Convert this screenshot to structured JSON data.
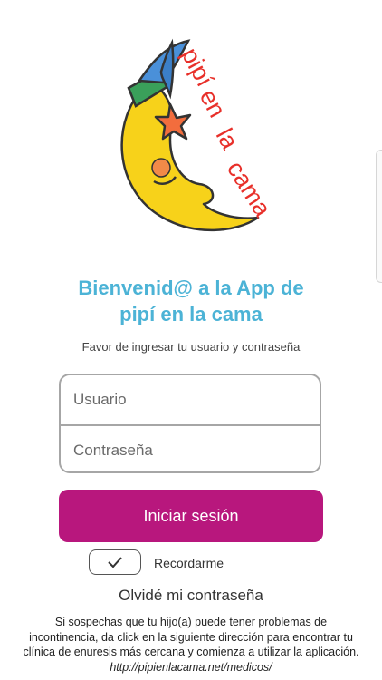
{
  "logo": {
    "icon": "moon-wizard-logo",
    "text": "pipí en la cama",
    "text_color": "#e8302a",
    "moon_color": "#f7d21a",
    "hat_color": "#4a90d9",
    "band_color": "#3aa05a",
    "star_color": "#f26d3d"
  },
  "welcome": {
    "line1": "Bienvenid@ a la App de",
    "line2": "pipí en la cama",
    "color": "#4cb3d6"
  },
  "instructions": "Favor de ingresar tu usuario y contraseña",
  "form": {
    "username_placeholder": "Usuario",
    "username_value": "",
    "password_placeholder": "Contraseña",
    "password_value": ""
  },
  "login_button": {
    "label": "Iniciar sesión",
    "color": "#b8177d"
  },
  "remember": {
    "label": "Recordarme",
    "checked": true,
    "icon": "check-icon"
  },
  "forgot_password": "Olvidé mi contraseña",
  "info": {
    "text": "Si sospechas que tu hijo(a) puede tener problemas de incontinencia, da click en la siguiente dirección para encontrar tu clínica de enuresis más cercana y comienza a utilizar la aplicación.",
    "link": "http://pipienlacama.net/medicos/"
  }
}
